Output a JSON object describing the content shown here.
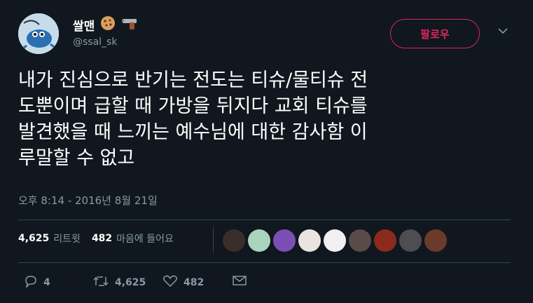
{
  "author": {
    "display_name": "쌀맨",
    "handle": "@ssal_sk",
    "name_emoji": [
      "cookie-icon",
      "pistol-icon"
    ]
  },
  "follow_button": {
    "label": "팔로우",
    "color": "#e0245e"
  },
  "tweet": {
    "lines": [
      "내가 진심으로 반기는 전도는 티슈/물티슈 전",
      "도뿐이며 급할 때 가방을 뒤지다 교회 티슈를",
      "발견했을 때 느끼는 예수님에 대한 감사함 이",
      "루말할 수 없고"
    ],
    "timestamp": "오후 8:14 - 2016년 8월 21일"
  },
  "stats": {
    "retweets_count": "4,625",
    "retweets_label": "리트윗",
    "likes_count": "482",
    "likes_label": "마음에 들어요",
    "liker_avatar_colors": [
      "#3a2e2a",
      "#a9d4bd",
      "#7a4fb5",
      "#e9e4de",
      "#f0f0f0",
      "#5a4a48",
      "#8a2b1d",
      "#4d4d52",
      "#6a3b2a"
    ]
  },
  "actions": {
    "reply_count": "4",
    "retweet_count": "4,625",
    "like_count": "482"
  },
  "colors": {
    "background": "#10171e",
    "text": "#ffffff",
    "muted": "#8899a6",
    "divider": "#38444d"
  }
}
